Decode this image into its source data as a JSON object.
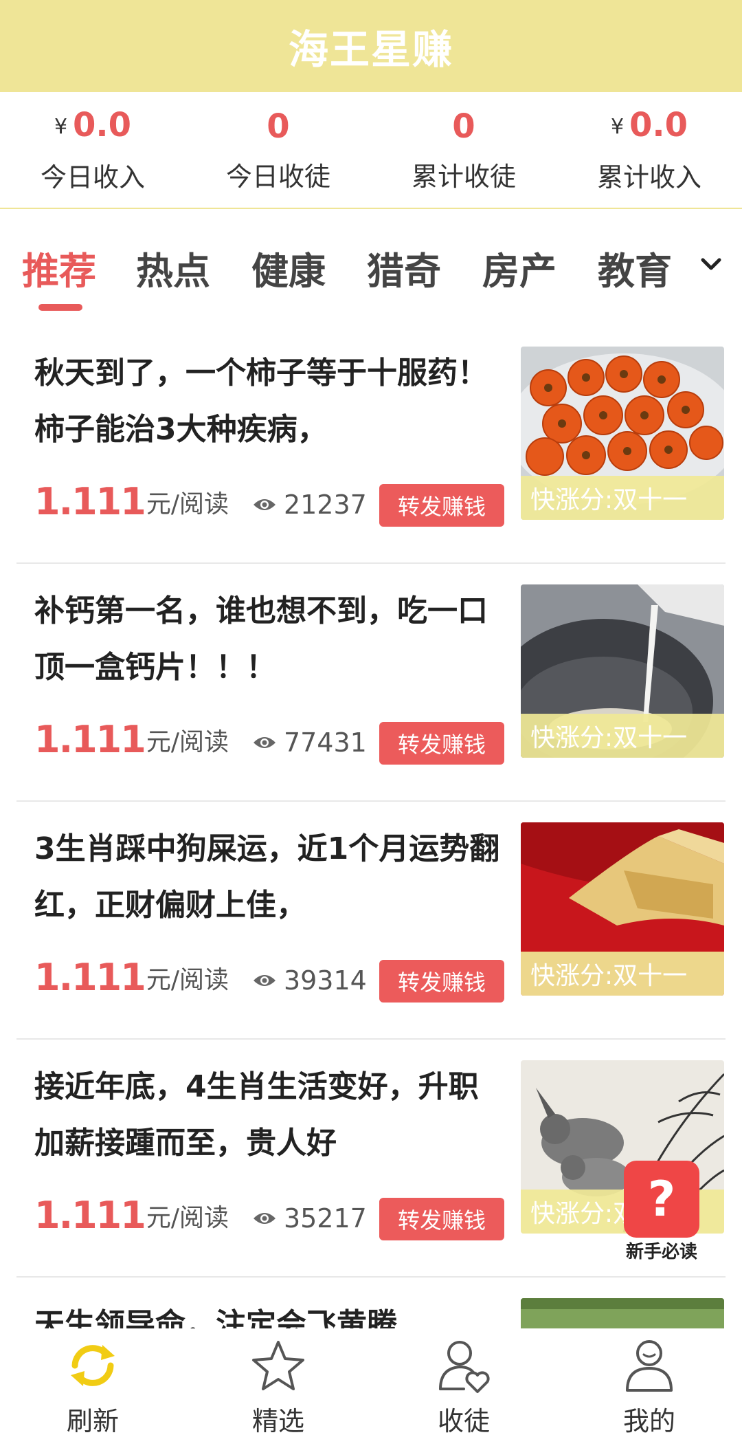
{
  "app": {
    "title": "海王星赚"
  },
  "stats": [
    {
      "prefix": "¥",
      "value": "0.0",
      "label": "今日收入"
    },
    {
      "prefix": "",
      "value": "0",
      "label": "今日收徒"
    },
    {
      "prefix": "",
      "value": "0",
      "label": "累计收徒"
    },
    {
      "prefix": "¥",
      "value": "0.0",
      "label": "累计收入"
    }
  ],
  "tabs": [
    "推荐",
    "热点",
    "健康",
    "猎奇",
    "房产",
    "教育"
  ],
  "active_tab": "推荐",
  "articles": [
    {
      "title": "秋天到了，一个柿子等于十服药！柿子能治3大种疾病，",
      "price": "1.111",
      "unit": "元/阅读",
      "views": "21237",
      "share": "转发赚钱",
      "tag": "快涨分:双十一"
    },
    {
      "title": "补钙第一名，谁也想不到，吃一口顶一盒钙片！！！",
      "price": "1.111",
      "unit": "元/阅读",
      "views": "77431",
      "share": "转发赚钱",
      "tag": "快涨分:双十一"
    },
    {
      "title": "3生肖踩中狗屎运，近1个月运势翻红，正财偏财上佳，",
      "price": "1.111",
      "unit": "元/阅读",
      "views": "39314",
      "share": "转发赚钱",
      "tag": "快涨分:双十一"
    },
    {
      "title": "接近年底，4生肖生活变好，升职加薪接踵而至，贵人好",
      "price": "1.111",
      "unit": "元/阅读",
      "views": "35217",
      "share": "转发赚钱",
      "tag": "快涨分:双十一"
    },
    {
      "title": "天生领导命，注定会飞黄腾"
    }
  ],
  "help": {
    "icon": "?",
    "label": "新手必读"
  },
  "nav": [
    {
      "label": "刷新",
      "icon": "refresh-icon",
      "active": true
    },
    {
      "label": "精选",
      "icon": "star-icon"
    },
    {
      "label": "收徒",
      "icon": "user-heart-icon"
    },
    {
      "label": "我的",
      "icon": "user-icon"
    }
  ],
  "colors": {
    "header_bg": "#efe597",
    "accent": "#e85a5a",
    "nav_active": "#f1cc14"
  }
}
